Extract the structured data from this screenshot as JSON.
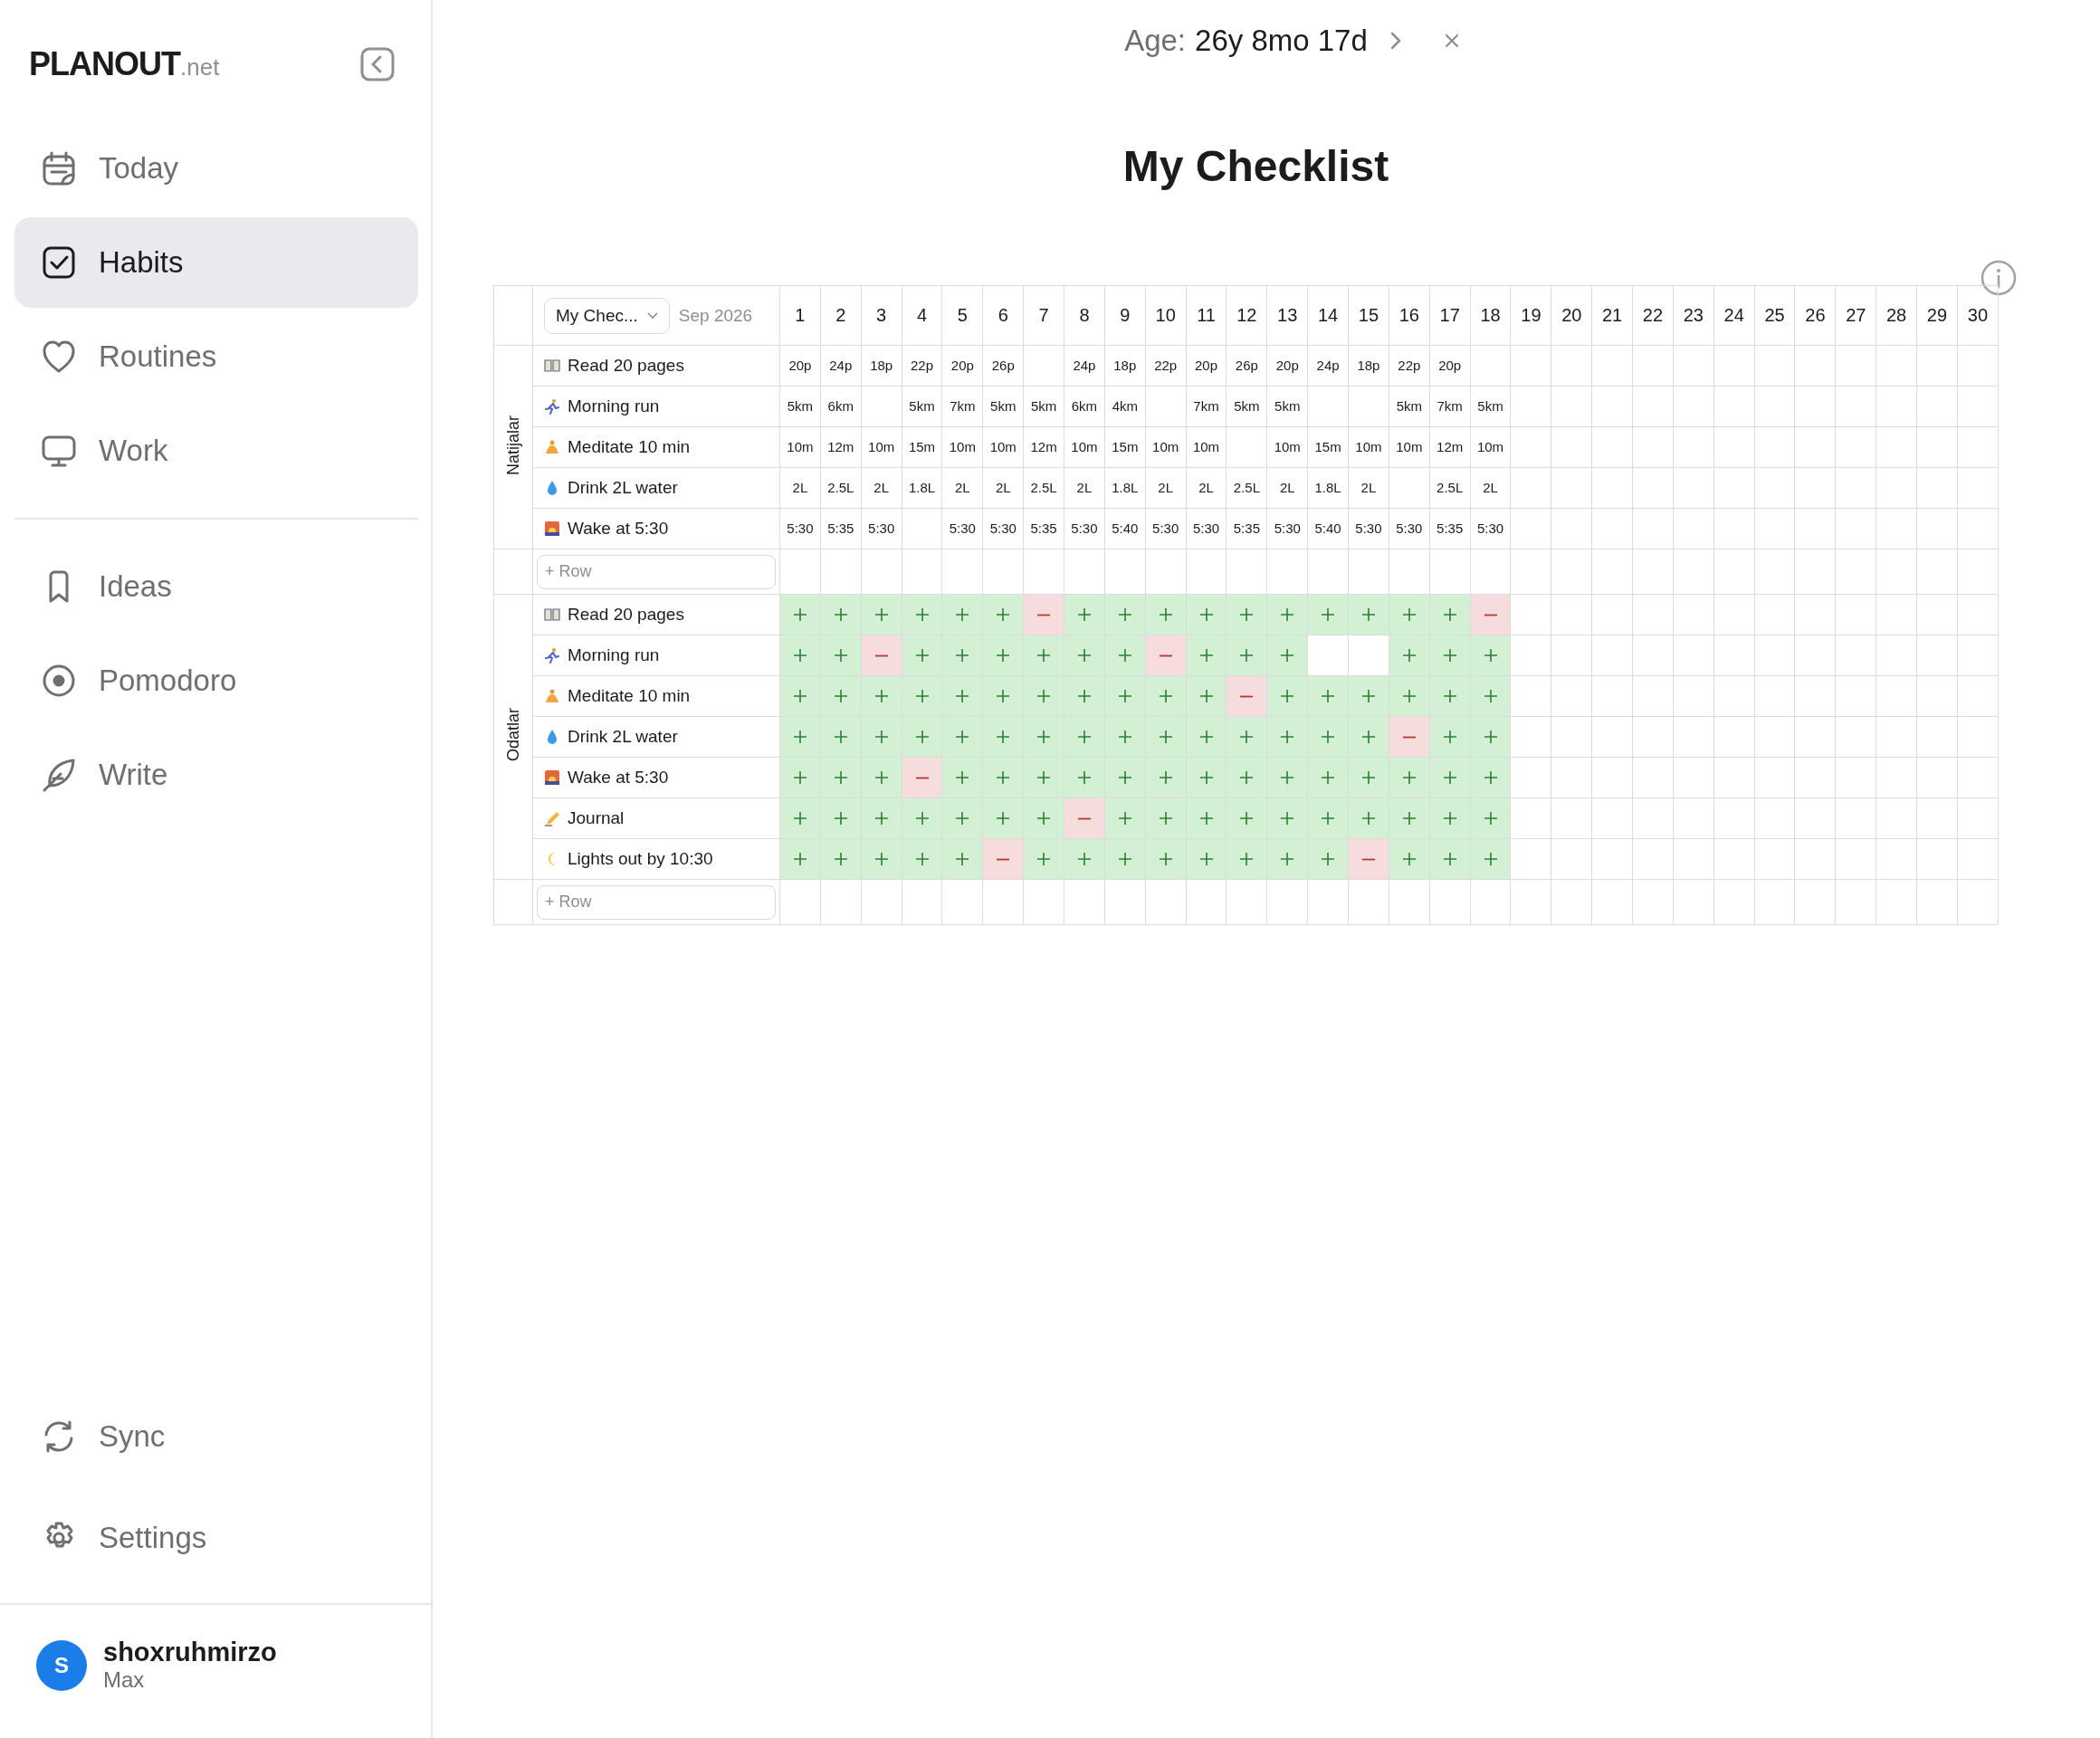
{
  "sidebar": {
    "logo": {
      "name": "PLANOUT",
      "suffix": ".net"
    },
    "nav": [
      {
        "label": "Today",
        "selected": false
      },
      {
        "label": "Habits",
        "selected": true
      },
      {
        "label": "Routines",
        "selected": false
      },
      {
        "label": "Work",
        "selected": false
      }
    ],
    "nav_more": [
      {
        "label": "Ideas",
        "selected": false
      },
      {
        "label": "Pomodoro",
        "selected": false
      },
      {
        "label": "Write",
        "selected": false
      }
    ],
    "nav_bottom": [
      {
        "label": "Sync",
        "selected": false
      },
      {
        "label": "Settings",
        "selected": false
      }
    ],
    "user": {
      "initial": "S",
      "name": "shoxruhmirzo",
      "plan": "Max"
    }
  },
  "header": {
    "age_label": "Age:",
    "age_value": "26y 8mo 17d"
  },
  "title": "My Checklist",
  "table": {
    "checklist": "My Chec...",
    "month": "Sep 2026",
    "days": [
      "1",
      "2",
      "3",
      "4",
      "5",
      "6",
      "7",
      "8",
      "9",
      "10",
      "11",
      "12",
      "13",
      "14",
      "15",
      "16",
      "17",
      "18",
      "19",
      "20",
      "21",
      "22",
      "23",
      "24",
      "25",
      "26",
      "27",
      "28",
      "29",
      "30"
    ],
    "results": {
      "label": "Natijalar",
      "add_placeholder": "+ Row",
      "rows": [
        {
          "name": "Read 20 pages",
          "cells": [
            {
              "kind": "value",
              "text": "20p"
            },
            {
              "kind": "value",
              "text": "24p"
            },
            {
              "kind": "value",
              "text": "18p"
            },
            {
              "kind": "value",
              "text": "22p"
            },
            {
              "kind": "value",
              "text": "20p"
            },
            {
              "kind": "value",
              "text": "26p"
            },
            {
              "kind": "empty"
            },
            {
              "kind": "value",
              "text": "24p"
            },
            {
              "kind": "value",
              "text": "18p"
            },
            {
              "kind": "value",
              "text": "22p"
            },
            {
              "kind": "value",
              "text": "20p"
            },
            {
              "kind": "value",
              "text": "26p"
            },
            {
              "kind": "value",
              "text": "20p"
            },
            {
              "kind": "value",
              "text": "24p"
            },
            {
              "kind": "value",
              "text": "18p"
            },
            {
              "kind": "value",
              "text": "22p"
            },
            {
              "kind": "value",
              "text": "20p"
            },
            {
              "kind": "empty"
            }
          ]
        },
        {
          "name": "Morning run",
          "cells": [
            {
              "kind": "value",
              "text": "5km"
            },
            {
              "kind": "value",
              "text": "6km"
            },
            {
              "kind": "empty"
            },
            {
              "kind": "value",
              "text": "5km"
            },
            {
              "kind": "value",
              "text": "7km"
            },
            {
              "kind": "value",
              "text": "5km"
            },
            {
              "kind": "value",
              "text": "5km"
            },
            {
              "kind": "value",
              "text": "6km"
            },
            {
              "kind": "value",
              "text": "4km"
            },
            {
              "kind": "empty"
            },
            {
              "kind": "value",
              "text": "7km"
            },
            {
              "kind": "value",
              "text": "5km"
            },
            {
              "kind": "value",
              "text": "5km"
            },
            {
              "kind": "empty"
            },
            {
              "kind": "empty"
            },
            {
              "kind": "value",
              "text": "5km"
            },
            {
              "kind": "value",
              "text": "7km"
            },
            {
              "kind": "value",
              "text": "5km"
            }
          ]
        },
        {
          "name": "Meditate 10 min",
          "cells": [
            {
              "kind": "value",
              "text": "10m"
            },
            {
              "kind": "value",
              "text": "12m"
            },
            {
              "kind": "value",
              "text": "10m"
            },
            {
              "kind": "value",
              "text": "15m"
            },
            {
              "kind": "value",
              "text": "10m"
            },
            {
              "kind": "value",
              "text": "10m"
            },
            {
              "kind": "value",
              "text": "12m"
            },
            {
              "kind": "value",
              "text": "10m"
            },
            {
              "kind": "value",
              "text": "15m"
            },
            {
              "kind": "value",
              "text": "10m"
            },
            {
              "kind": "value",
              "text": "10m"
            },
            {
              "kind": "empty"
            },
            {
              "kind": "value",
              "text": "10m"
            },
            {
              "kind": "value",
              "text": "15m"
            },
            {
              "kind": "value",
              "text": "10m"
            },
            {
              "kind": "value",
              "text": "10m"
            },
            {
              "kind": "value",
              "text": "12m"
            },
            {
              "kind": "value",
              "text": "10m"
            }
          ]
        },
        {
          "name": "Drink 2L water",
          "cells": [
            {
              "kind": "value",
              "text": "2L"
            },
            {
              "kind": "value",
              "text": "2.5L"
            },
            {
              "kind": "value",
              "text": "2L"
            },
            {
              "kind": "value",
              "text": "1.8L"
            },
            {
              "kind": "value",
              "text": "2L"
            },
            {
              "kind": "value",
              "text": "2L"
            },
            {
              "kind": "value",
              "text": "2.5L"
            },
            {
              "kind": "value",
              "text": "2L"
            },
            {
              "kind": "value",
              "text": "1.8L"
            },
            {
              "kind": "value",
              "text": "2L"
            },
            {
              "kind": "value",
              "text": "2L"
            },
            {
              "kind": "value",
              "text": "2.5L"
            },
            {
              "kind": "value",
              "text": "2L"
            },
            {
              "kind": "value",
              "text": "1.8L"
            },
            {
              "kind": "value",
              "text": "2L"
            },
            {
              "kind": "empty"
            },
            {
              "kind": "value",
              "text": "2.5L"
            },
            {
              "kind": "value",
              "text": "2L"
            }
          ]
        },
        {
          "name": "Wake at 5:30",
          "cells": [
            {
              "kind": "value",
              "text": "5:30"
            },
            {
              "kind": "value",
              "text": "5:35"
            },
            {
              "kind": "value",
              "text": "5:30"
            },
            {
              "kind": "empty"
            },
            {
              "kind": "value",
              "text": "5:30"
            },
            {
              "kind": "value",
              "text": "5:30"
            },
            {
              "kind": "value",
              "text": "5:35"
            },
            {
              "kind": "value",
              "text": "5:30"
            },
            {
              "kind": "value",
              "text": "5:40"
            },
            {
              "kind": "value",
              "text": "5:30"
            },
            {
              "kind": "value",
              "text": "5:30"
            },
            {
              "kind": "value",
              "text": "5:35"
            },
            {
              "kind": "value",
              "text": "5:30"
            },
            {
              "kind": "value",
              "text": "5:40"
            },
            {
              "kind": "value",
              "text": "5:30"
            },
            {
              "kind": "value",
              "text": "5:30"
            },
            {
              "kind": "value",
              "text": "5:35"
            },
            {
              "kind": "value",
              "text": "5:30"
            }
          ]
        }
      ]
    },
    "habits": {
      "label": "Odatlar",
      "add_placeholder": "+ Row",
      "rows": [
        {
          "name": "Read 20 pages",
          "marks": [
            {
              "kind": "done"
            },
            {
              "kind": "done"
            },
            {
              "kind": "done"
            },
            {
              "kind": "done"
            },
            {
              "kind": "done"
            },
            {
              "kind": "done"
            },
            {
              "kind": "missed"
            },
            {
              "kind": "done"
            },
            {
              "kind": "done"
            },
            {
              "kind": "done"
            },
            {
              "kind": "done"
            },
            {
              "kind": "done"
            },
            {
              "kind": "done"
            },
            {
              "kind": "done"
            },
            {
              "kind": "done"
            },
            {
              "kind": "done"
            },
            {
              "kind": "done"
            },
            {
              "kind": "missed"
            }
          ]
        },
        {
          "name": "Morning run",
          "marks": [
            {
              "kind": "done"
            },
            {
              "kind": "done"
            },
            {
              "kind": "missed"
            },
            {
              "kind": "done"
            },
            {
              "kind": "done"
            },
            {
              "kind": "done"
            },
            {
              "kind": "done"
            },
            {
              "kind": "done"
            },
            {
              "kind": "done"
            },
            {
              "kind": "missed"
            },
            {
              "kind": "done"
            },
            {
              "kind": "done"
            },
            {
              "kind": "done"
            },
            {
              "kind": "empty"
            },
            {
              "kind": "empty"
            },
            {
              "kind": "done"
            },
            {
              "kind": "done"
            },
            {
              "kind": "done"
            }
          ]
        },
        {
          "name": "Meditate 10 min",
          "marks": [
            {
              "kind": "done"
            },
            {
              "kind": "done"
            },
            {
              "kind": "done"
            },
            {
              "kind": "done"
            },
            {
              "kind": "done"
            },
            {
              "kind": "done"
            },
            {
              "kind": "done"
            },
            {
              "kind": "done"
            },
            {
              "kind": "done"
            },
            {
              "kind": "done"
            },
            {
              "kind": "done"
            },
            {
              "kind": "missed"
            },
            {
              "kind": "done"
            },
            {
              "kind": "done"
            },
            {
              "kind": "done"
            },
            {
              "kind": "done"
            },
            {
              "kind": "done"
            },
            {
              "kind": "done"
            }
          ]
        },
        {
          "name": "Drink 2L water",
          "marks": [
            {
              "kind": "done"
            },
            {
              "kind": "done"
            },
            {
              "kind": "done"
            },
            {
              "kind": "done"
            },
            {
              "kind": "done"
            },
            {
              "kind": "done"
            },
            {
              "kind": "done"
            },
            {
              "kind": "done"
            },
            {
              "kind": "done"
            },
            {
              "kind": "done"
            },
            {
              "kind": "done"
            },
            {
              "kind": "done"
            },
            {
              "kind": "done"
            },
            {
              "kind": "done"
            },
            {
              "kind": "done"
            },
            {
              "kind": "missed"
            },
            {
              "kind": "done"
            },
            {
              "kind": "done"
            }
          ]
        },
        {
          "name": "Wake at 5:30",
          "marks": [
            {
              "kind": "done"
            },
            {
              "kind": "done"
            },
            {
              "kind": "done"
            },
            {
              "kind": "missed"
            },
            {
              "kind": "done"
            },
            {
              "kind": "done"
            },
            {
              "kind": "done"
            },
            {
              "kind": "done"
            },
            {
              "kind": "done"
            },
            {
              "kind": "done"
            },
            {
              "kind": "done"
            },
            {
              "kind": "done"
            },
            {
              "kind": "done"
            },
            {
              "kind": "done"
            },
            {
              "kind": "done"
            },
            {
              "kind": "done"
            },
            {
              "kind": "done"
            },
            {
              "kind": "done"
            }
          ]
        },
        {
          "name": "Journal",
          "marks": [
            {
              "kind": "done"
            },
            {
              "kind": "done"
            },
            {
              "kind": "done"
            },
            {
              "kind": "done"
            },
            {
              "kind": "done"
            },
            {
              "kind": "done"
            },
            {
              "kind": "done"
            },
            {
              "kind": "missed"
            },
            {
              "kind": "done"
            },
            {
              "kind": "done"
            },
            {
              "kind": "done"
            },
            {
              "kind": "done"
            },
            {
              "kind": "done"
            },
            {
              "kind": "done"
            },
            {
              "kind": "done"
            },
            {
              "kind": "done"
            },
            {
              "kind": "done"
            },
            {
              "kind": "done"
            }
          ]
        },
        {
          "name": "Lights out by 10:30",
          "marks": [
            {
              "kind": "done"
            },
            {
              "kind": "done"
            },
            {
              "kind": "done"
            },
            {
              "kind": "done"
            },
            {
              "kind": "done"
            },
            {
              "kind": "missed"
            },
            {
              "kind": "done"
            },
            {
              "kind": "done"
            },
            {
              "kind": "done"
            },
            {
              "kind": "done"
            },
            {
              "kind": "done"
            },
            {
              "kind": "done"
            },
            {
              "kind": "done"
            },
            {
              "kind": "done"
            },
            {
              "kind": "missed"
            },
            {
              "kind": "done"
            },
            {
              "kind": "done"
            },
            {
              "kind": "done"
            }
          ]
        }
      ]
    }
  }
}
